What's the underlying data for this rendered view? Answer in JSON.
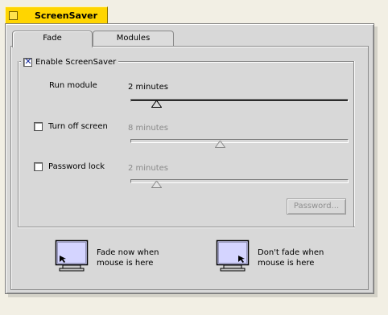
{
  "window": {
    "title": "ScreenSaver"
  },
  "tabs": [
    {
      "label": "Fade",
      "active": true
    },
    {
      "label": "Modules",
      "active": false
    }
  ],
  "enable_screensaver": {
    "label": "Enable ScreenSaver",
    "checked": true
  },
  "run_module": {
    "label": "Run module",
    "value": "2 minutes",
    "level": 0.12
  },
  "turn_off_screen": {
    "label": "Turn off screen",
    "checked": false,
    "value": "8 minutes",
    "level": 0.41
  },
  "password_lock": {
    "label": "Password lock",
    "checked": false,
    "value": "2 minutes",
    "level": 0.12
  },
  "password_button": {
    "label": "Password..."
  },
  "corners": {
    "fade_now": {
      "line1": "Fade now when",
      "line2": "mouse is here"
    },
    "dont_fade": {
      "line1": "Don't fade when",
      "line2": "mouse is here"
    }
  },
  "colors": {
    "title_bar": "#ffd500",
    "panel": "#d8d8d8",
    "check_mark": "#1a2fa0",
    "monitor_screen": "#d4d4ff"
  },
  "icons": [
    "window-close-box-icon",
    "checkmark-icon",
    "slider-thumb-icon",
    "monitor-icon",
    "mouse-cursor-icon"
  ]
}
